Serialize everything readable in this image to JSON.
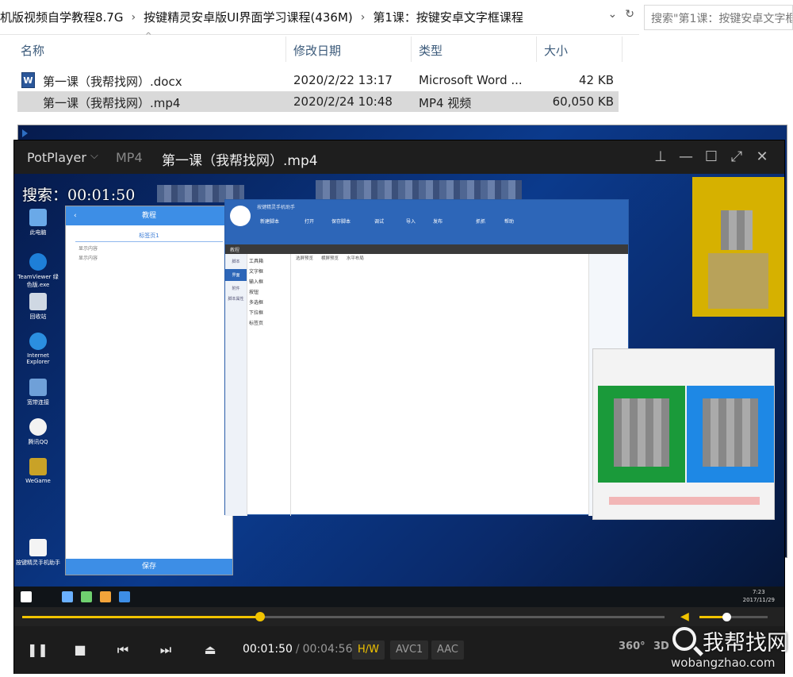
{
  "explorer": {
    "breadcrumb": [
      "机版视频自学教程8.7G",
      "按键精灵安卓版UI界面学习课程(436M)",
      "第1课：按键安卓文字框课程"
    ],
    "search_placeholder": "搜索\"第1课：按键安卓文字框",
    "columns": {
      "name": "名称",
      "date": "修改日期",
      "type": "类型",
      "size": "大小"
    },
    "files": [
      {
        "name": "第一课（我帮找网）.docx",
        "date": "2020/2/22 13:17",
        "type": "Microsoft Word ...",
        "size": "42 KB",
        "icon": "word-doc-icon",
        "selected": false
      },
      {
        "name": "第一课（我帮找网）.mp4",
        "date": "2020/2/24 10:48",
        "type": "MP4 视频",
        "size": "60,050 KB",
        "icon": "video-file-icon",
        "selected": true
      }
    ]
  },
  "player": {
    "brand": "PotPlayer",
    "format": "MP4",
    "title": "第一课（我帮找网）.mp4",
    "search_badge": "搜索：00:01:50",
    "current_time": "00:01:50",
    "duration": "00:04:56",
    "progress_fraction": 0.37,
    "volume_fraction": 0.4,
    "badges": {
      "hw": "H/W",
      "video_codec": "AVC1",
      "audio_codec": "AAC"
    },
    "right_controls": {
      "r360": "360°",
      "r3d": "3D"
    },
    "accent_color": "#f2c400"
  },
  "video_content": {
    "desktop_icons": [
      "此电脑",
      "TeamViewer 绿色版.exe",
      "回收站",
      "Internet Explorer",
      "宽带连接",
      "腾讯QQ",
      "WeGame",
      "按键精灵手机助手"
    ],
    "phone": {
      "header": "教程",
      "tab": "标签页1",
      "lines": [
        "显示内容",
        "显示内容"
      ],
      "save": "保存"
    },
    "ide": {
      "title": "按键精灵手机助手",
      "toolbar": [
        "新建脚本",
        "打开",
        "保存脚本",
        "调试",
        "导入",
        "发布",
        "抓抓",
        "帮助"
      ],
      "doc_tab": "教程",
      "sidebar": [
        "脚本",
        "界面",
        "附件",
        "脚本属性"
      ],
      "toolbox_title": "工具箱",
      "tools": [
        "文字框",
        "输入框",
        "按钮",
        "多选框",
        "下拉框",
        "标签页"
      ],
      "layout_bar": [
        "选屏预览",
        "横屏预览",
        "水平布局"
      ]
    },
    "clock": {
      "time": "7:23",
      "date": "2017/11/29"
    }
  },
  "watermark": {
    "big": "我帮找网",
    "small": "wobangzhao.com"
  }
}
